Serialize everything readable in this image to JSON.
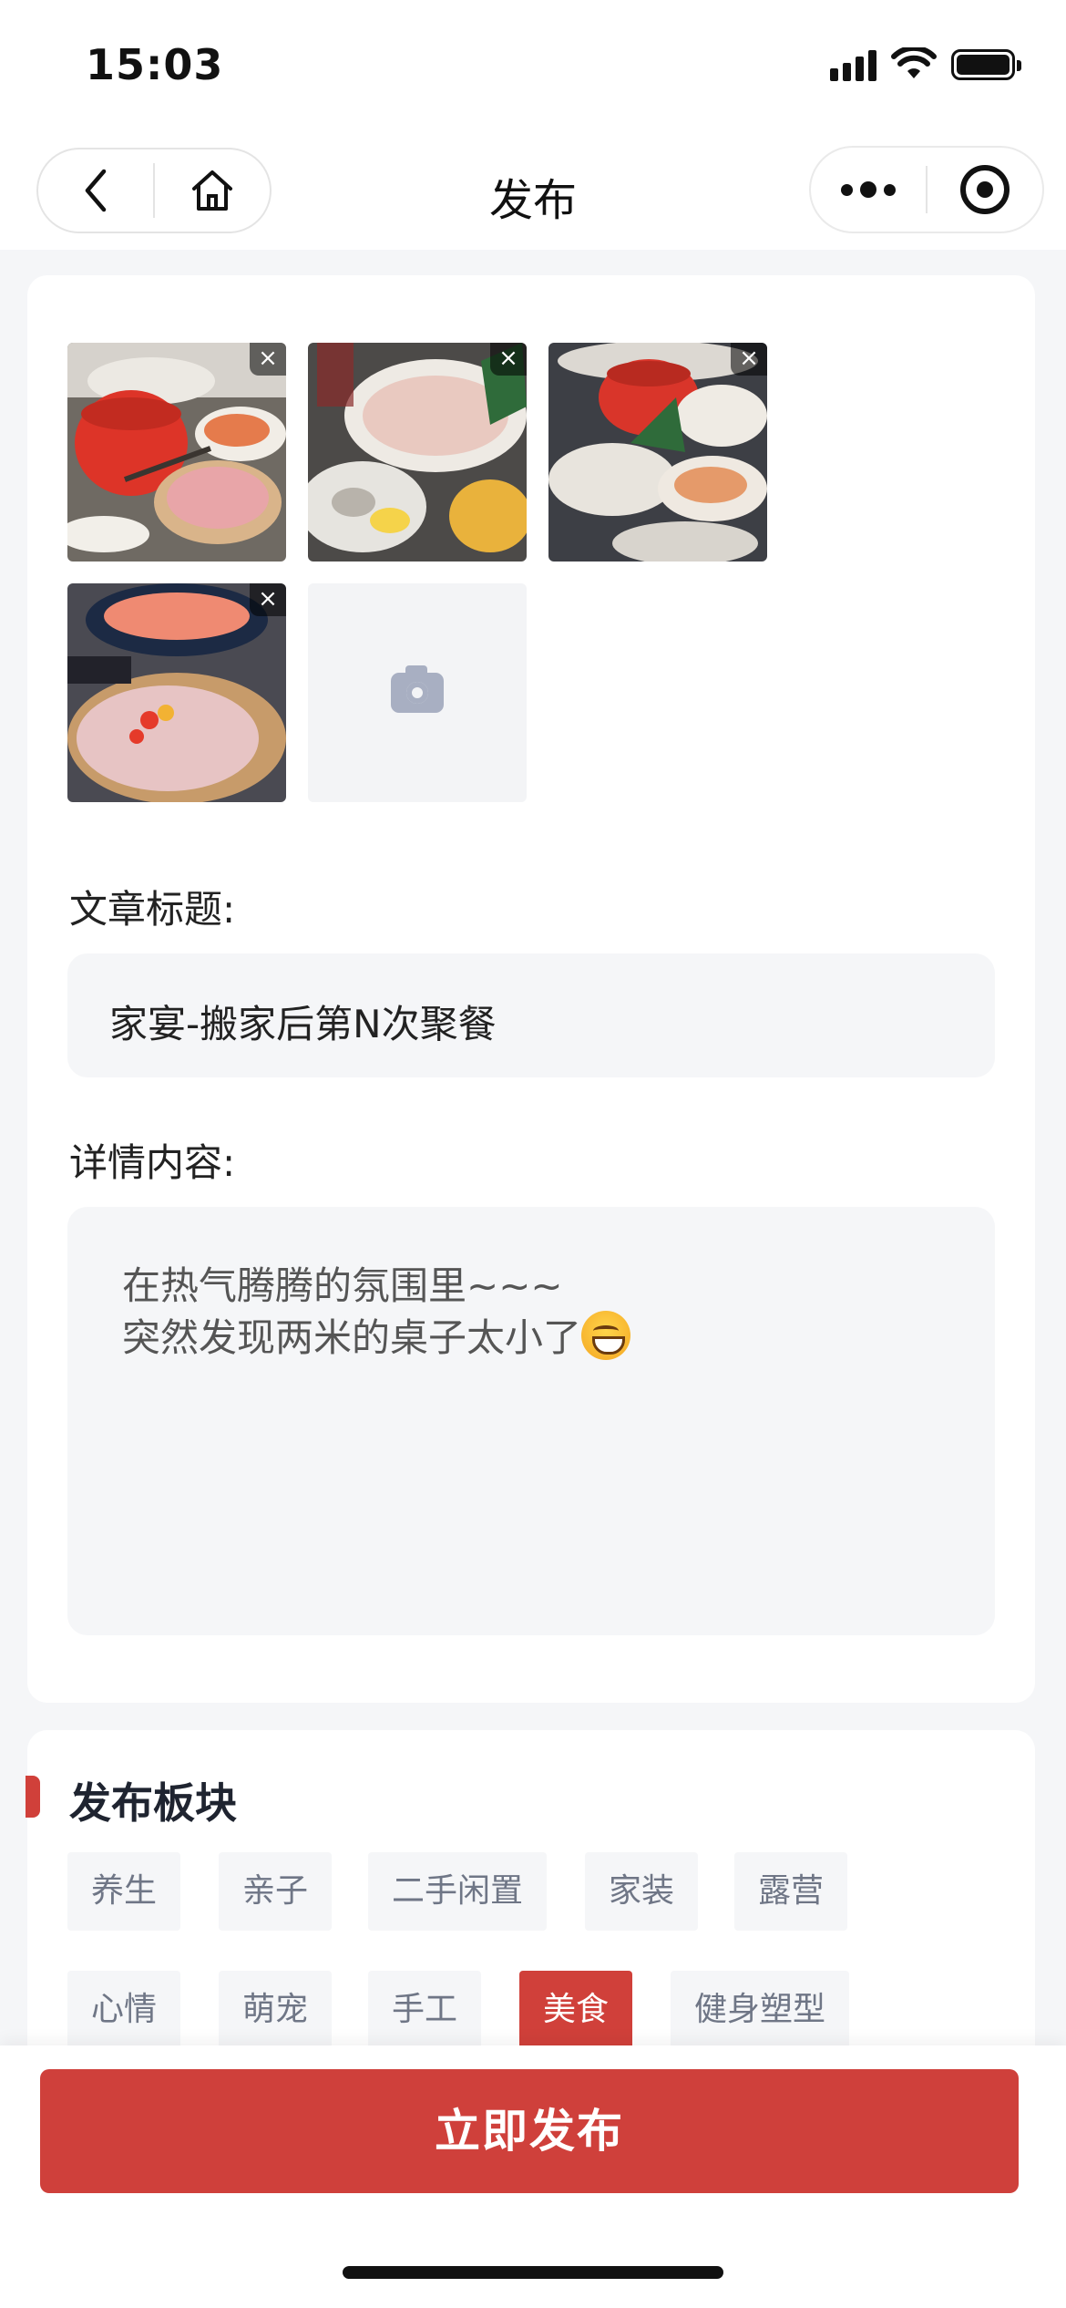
{
  "status_bar": {
    "time": "15:03"
  },
  "nav": {
    "title": "发布",
    "icons": [
      "back-icon",
      "home-icon",
      "more-icon",
      "target-icon"
    ]
  },
  "photos": {
    "items": [
      {
        "alt": "hotpot-table-photo-1"
      },
      {
        "alt": "seafood-platter-photo-2"
      },
      {
        "alt": "dinner-table-photo-3"
      },
      {
        "alt": "salmon-and-meat-photo-4"
      }
    ],
    "delete_label": "×",
    "add_icon": "camera-icon"
  },
  "form": {
    "title_label": "文章标题:",
    "title_value": "家宴-搬家后第N次聚餐",
    "content_label": "详情内容:",
    "content_line1": "在热气腾腾的氛围里~~~",
    "content_line2": "突然发现两米的桌子太小了"
  },
  "board": {
    "title": "发布板块",
    "tags": [
      "养生",
      "亲子",
      "二手闲置",
      "家装",
      "露营",
      "心情",
      "萌宠",
      "手工",
      "美食",
      "健身塑型"
    ],
    "selected": "美食",
    "accent_color": "#d0403a"
  },
  "publish_button": "立即发布"
}
